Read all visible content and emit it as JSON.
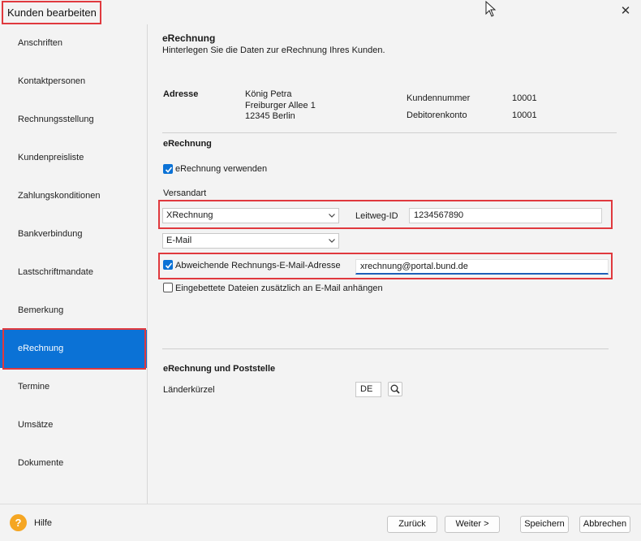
{
  "window": {
    "title": "Kunden bearbeiten",
    "close_glyph": "✕"
  },
  "sidebar": {
    "items": [
      {
        "label": "Anschriften"
      },
      {
        "label": "Kontaktpersonen"
      },
      {
        "label": "Rechnungsstellung"
      },
      {
        "label": "Kundenpreisliste"
      },
      {
        "label": "Zahlungskonditionen"
      },
      {
        "label": "Bankverbindung"
      },
      {
        "label": "Lastschriftmandate"
      },
      {
        "label": "Bemerkung"
      },
      {
        "label": "eRechnung"
      },
      {
        "label": "Termine"
      },
      {
        "label": "Umsätze"
      },
      {
        "label": "Dokumente"
      }
    ],
    "active_index": 8,
    "active_color": "#0b72d6"
  },
  "header": {
    "title": "eRechnung",
    "subtitle": "Hinterlegen Sie die Daten zur eRechnung Ihres Kunden."
  },
  "address": {
    "label": "Adresse",
    "name": "König Petra",
    "street": "Freiburger Allee 1",
    "city": "12345 Berlin",
    "customer_number_label": "Kundennummer",
    "customer_number": "10001",
    "debtor_account_label": "Debitorenkonto",
    "debtor_account": "10001"
  },
  "erechnung": {
    "section_title": "eRechnung",
    "use_checkbox_label": "eRechnung verwenden",
    "use_checked": true,
    "shipping_label": "Versandart",
    "format_select_value": "XRechnung",
    "leitweg_label": "Leitweg-ID",
    "leitweg_value": "1234567890",
    "channel_select_value": "E-Mail",
    "alt_email_label": "Abweichende Rechnungs-E-Mail-Adresse",
    "alt_email_checked": true,
    "alt_email_value": "xrechnung@portal.bund.de",
    "attach_label": "Eingebettete Dateien zusätzlich an E-Mail anhängen",
    "attach_checked": false
  },
  "poststelle": {
    "section_title": "eRechnung und Poststelle",
    "country_label": "Länderkürzel",
    "country_value": "DE"
  },
  "footer": {
    "help_glyph": "?",
    "help_label": "Hilfe",
    "back_label": "Zurück",
    "next_label": "Weiter >",
    "save_label": "Speichern",
    "cancel_label": "Abbrechen"
  },
  "colors": {
    "highlight": "#e0393e",
    "accent": "#0b72d6",
    "help": "#f5a623"
  }
}
